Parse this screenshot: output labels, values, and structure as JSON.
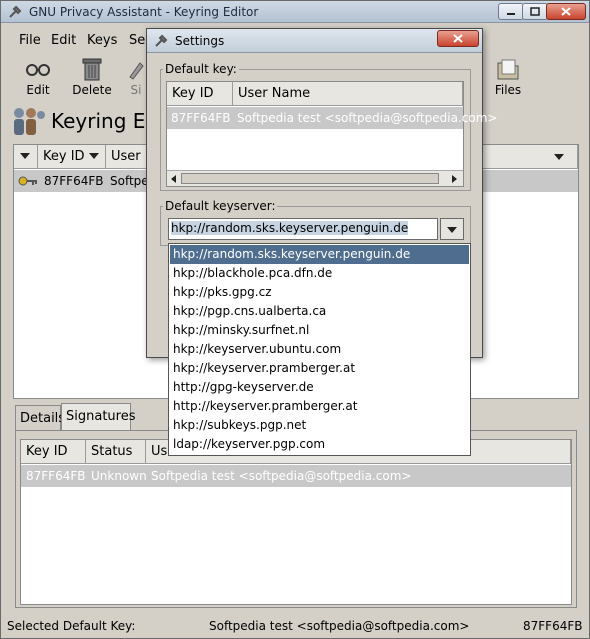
{
  "window": {
    "title": "GNU Privacy Assistant - Keyring Editor"
  },
  "menu": [
    "File",
    "Edit",
    "Keys",
    "Se"
  ],
  "toolbar": {
    "edit": "Edit",
    "delete": "Delete",
    "sign": "Si",
    "files": "Files"
  },
  "heading": "Keyring Editor",
  "keylist": {
    "columns": [
      "Key ID",
      "User N"
    ],
    "rows": [
      {
        "key_id": "87FF64FB",
        "user": "Softpe"
      }
    ]
  },
  "tabs": [
    "Details",
    "Signatures"
  ],
  "signatures": {
    "columns": [
      "Key ID",
      "Status",
      "Use"
    ],
    "rows": [
      {
        "key_id": "87FF64FB",
        "status": "Unknown",
        "user": "Softpedia test <softpedia@softpedia.com>"
      }
    ]
  },
  "statusbar": {
    "label": "Selected Default Key:",
    "user": "Softpedia test <softpedia@softpedia.com>",
    "key_id": "87FF64FB"
  },
  "settings": {
    "title": "Settings",
    "default_key_label": "Default key:",
    "default_key_columns": [
      "Key ID",
      "User Name"
    ],
    "default_key_row": {
      "key_id": "87FF64FB",
      "user": "Softpedia test <softpedia@softpedia.com>"
    },
    "default_keyserver_label": "Default keyserver:",
    "keyserver_value": "hkp://random.sks.keyserver.penguin.de",
    "keyserver_options": [
      "hkp://random.sks.keyserver.penguin.de",
      "hkp://blackhole.pca.dfn.de",
      "hkp://pks.gpg.cz",
      "hkp://pgp.cns.ualberta.ca",
      "hkp://minsky.surfnet.nl",
      "hkp://keyserver.ubuntu.com",
      "hkp://keyserver.pramberger.at",
      "http://gpg-keyserver.de",
      "http://keyserver.pramberger.at",
      "hkp://subkeys.pgp.net",
      "ldap://keyserver.pgp.com"
    ]
  }
}
